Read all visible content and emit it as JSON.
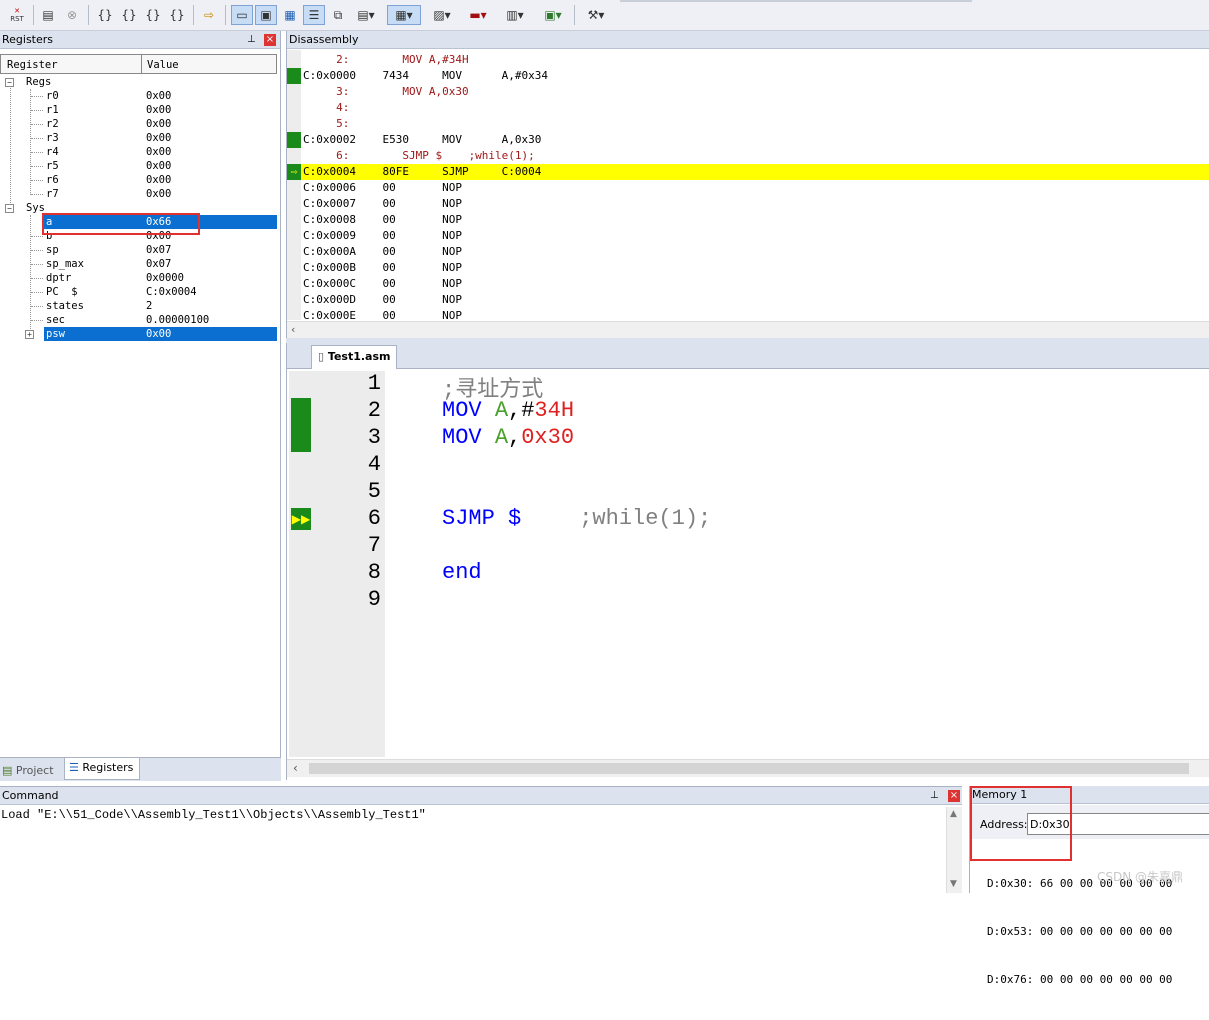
{
  "registers": {
    "title": "Registers",
    "col_register": "Register",
    "col_value": "Value",
    "groups": {
      "regs": "Regs",
      "sys": "Sys"
    },
    "regs": [
      {
        "name": "r0",
        "value": "0x00"
      },
      {
        "name": "r1",
        "value": "0x00"
      },
      {
        "name": "r2",
        "value": "0x00"
      },
      {
        "name": "r3",
        "value": "0x00"
      },
      {
        "name": "r4",
        "value": "0x00"
      },
      {
        "name": "r5",
        "value": "0x00"
      },
      {
        "name": "r6",
        "value": "0x00"
      },
      {
        "name": "r7",
        "value": "0x00"
      }
    ],
    "sys": [
      {
        "name": "a",
        "value": "0x66"
      },
      {
        "name": "b",
        "value": "0x00"
      },
      {
        "name": "sp",
        "value": "0x07"
      },
      {
        "name": "sp_max",
        "value": "0x07"
      },
      {
        "name": "dptr",
        "value": "0x0000"
      },
      {
        "name": "PC  $",
        "value": "C:0x0004"
      },
      {
        "name": "states",
        "value": "2"
      },
      {
        "name": "sec",
        "value": "0.00000100"
      },
      {
        "name": "psw",
        "value": "0x00"
      }
    ],
    "tabs": {
      "project": "Project",
      "registers": "Registers"
    },
    "pin": "ₕ",
    "close": "×"
  },
  "disassembly": {
    "title": "Disassembly",
    "lines": [
      "     2:        MOV A,#34H",
      "C:0x0000    7434     MOV      A,#0x34",
      "     3:        MOV A,0x30",
      "     4:",
      "     5:",
      "C:0x0002    E530     MOV      A,0x30",
      "     6:        SJMP $    ;while(1);",
      "C:0x0004    80FE     SJMP     C:0004",
      "C:0x0006    00       NOP",
      "C:0x0007    00       NOP",
      "C:0x0008    00       NOP",
      "C:0x0009    00       NOP",
      "C:0x000A    00       NOP",
      "C:0x000B    00       NOP",
      "C:0x000C    00       NOP",
      "C:0x000D    00       NOP",
      "C:0x000E    00       NOP"
    ]
  },
  "editor": {
    "tab": "Test1.asm",
    "line_numbers": [
      "1",
      "2",
      "3",
      "4",
      "5",
      "6",
      "7",
      "8",
      "9"
    ],
    "l1": ";寻址方式",
    "l2_op": "MOV ",
    "l2_reg": "A",
    "l2_comma": ",",
    "l2_hash": "#",
    "l2_num": "34H",
    "l3_op": "MOV ",
    "l3_reg": "A",
    "l3_comma": ",",
    "l3_num": "0x30",
    "l6_op": "SJMP $",
    "l6_cmt": ";while(1);",
    "l8": "end"
  },
  "command": {
    "title": "Command",
    "text": "Load \"E:\\\\51_Code\\\\Assembly_Test1\\\\Objects\\\\Assembly_Test1\""
  },
  "memory": {
    "title": "Memory 1",
    "address_label": "Address:",
    "address_value": "D:0x30",
    "rows": [
      "D:0x30: 66 00 00 00 00 00 00",
      "D:0x53: 00 00 00 00 00 00 00",
      "D:0x76: 00 00 00 00 00 00 00"
    ]
  },
  "watermark": "CSDN @朱嘉鼎"
}
